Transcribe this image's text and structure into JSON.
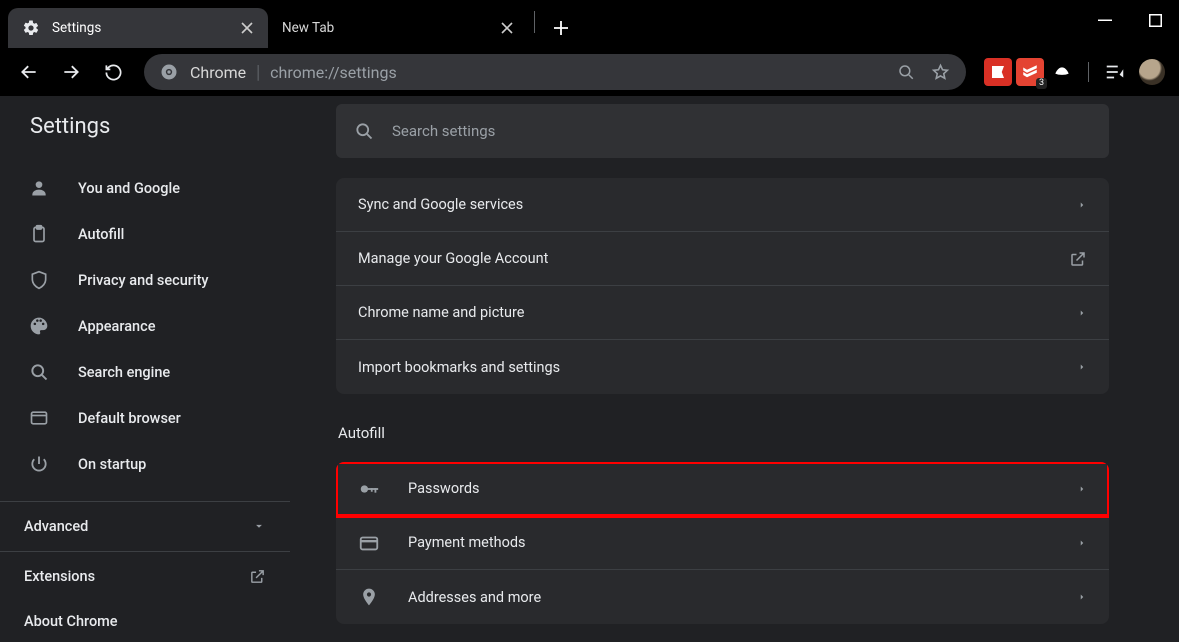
{
  "window": {
    "tabs": [
      {
        "title": "Settings",
        "active": true
      },
      {
        "title": "New Tab",
        "active": false
      }
    ]
  },
  "omnibox": {
    "chip": "Chrome",
    "url": "chrome://settings"
  },
  "extensions": {
    "badge_count": "3"
  },
  "sidebar": {
    "title": "Settings",
    "items": [
      {
        "label": "You and Google",
        "icon": "person"
      },
      {
        "label": "Autofill",
        "icon": "clipboard"
      },
      {
        "label": "Privacy and security",
        "icon": "shield"
      },
      {
        "label": "Appearance",
        "icon": "palette"
      },
      {
        "label": "Search engine",
        "icon": "search"
      },
      {
        "label": "Default browser",
        "icon": "browser"
      },
      {
        "label": "On startup",
        "icon": "power"
      }
    ],
    "advanced": "Advanced",
    "extensions": "Extensions",
    "about": "About Chrome"
  },
  "search": {
    "placeholder": "Search settings"
  },
  "sections": {
    "you_and_google": {
      "rows": [
        {
          "label": "Sync and Google services",
          "trailing": "arrow"
        },
        {
          "label": "Manage your Google Account",
          "trailing": "launch"
        },
        {
          "label": "Chrome name and picture",
          "trailing": "arrow"
        },
        {
          "label": "Import bookmarks and settings",
          "trailing": "arrow"
        }
      ]
    },
    "autofill": {
      "title": "Autofill",
      "rows": [
        {
          "label": "Passwords",
          "icon": "key",
          "highlight": true
        },
        {
          "label": "Payment methods",
          "icon": "card"
        },
        {
          "label": "Addresses and more",
          "icon": "place"
        }
      ]
    }
  }
}
